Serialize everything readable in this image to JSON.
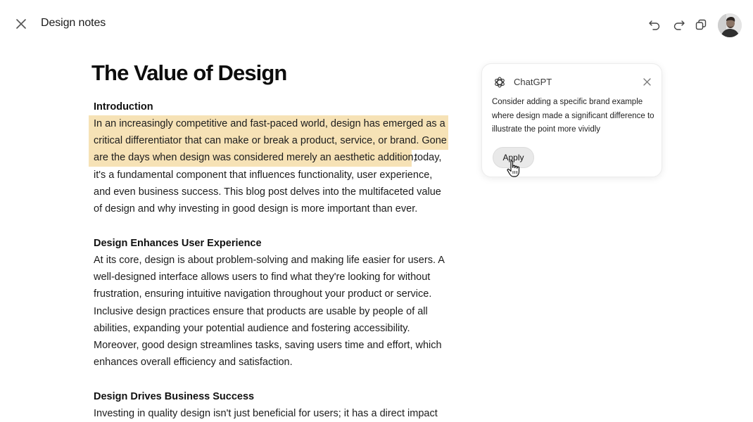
{
  "header": {
    "title": "Design notes",
    "icons": [
      "close-icon",
      "undo-icon",
      "redo-icon",
      "copy-icon",
      "avatar"
    ]
  },
  "document": {
    "title": "The Value of Design",
    "sections": [
      {
        "heading": "Introduction",
        "highlight_lines": [
          "In an increasingly competitive and fast-paced world, design has emerged as a",
          "critical differentiator that can make or break a product, service, or brand. Gone",
          "are the days when design was considered merely an aesthetic addition;"
        ],
        "continuation": "today,",
        "lines": [
          "it's a fundamental component that influences functionality, user experience,",
          "and even business success. This blog post delves into the multifaceted value",
          "of design and why investing in good design is more important than ever."
        ]
      },
      {
        "heading": "Design Enhances User Experience",
        "lines": [
          "At its core, design is about problem-solving and making life easier for users. A",
          "well-designed interface allows users to find what they're looking for without",
          "frustration, ensuring intuitive navigation throughout your product or service.",
          "Inclusive design practices ensure that products are usable by people of all",
          "abilities, expanding your potential audience and fostering accessibility.",
          "Moreover, good design streamlines tasks, saving users time and effort, which",
          "enhances overall efficiency and satisfaction."
        ]
      },
      {
        "heading": "Design Drives Business Success",
        "lines": [
          "Investing in quality design isn't just beneficial for users; it has a direct impact"
        ]
      }
    ]
  },
  "suggestion": {
    "assistant_name": "ChatGPT",
    "body": "Consider adding a specific brand example where design made a significant difference to illustrate the point more vividly",
    "apply_label": "Apply"
  },
  "colors": {
    "highlight": "#f6e2b6",
    "text": "#1c1c1c",
    "button_bg": "#e9e9e9"
  }
}
